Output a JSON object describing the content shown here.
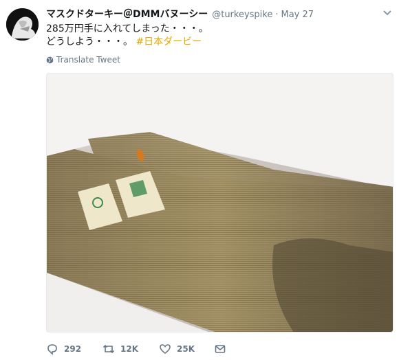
{
  "tweet": {
    "display_name": "マスクドターキー＠DMMバヌーシー",
    "handle": "@turkeyspike",
    "separator": "·",
    "date": "May 27",
    "text_line1": "285万円手に入れてしまった・・・。",
    "text_line2": "どうしよう・・・。",
    "hashtag": "#日本ダービー",
    "translate_label": "Translate Tweet",
    "stats": {
      "replies": "292",
      "retweets": "12K",
      "likes": "25K"
    },
    "colors": {
      "hashtag": "#e6a800",
      "meta": "#657786",
      "text": "#14171a"
    },
    "icons": [
      "chevron-down-icon",
      "globe-icon",
      "reply-icon",
      "retweet-icon",
      "heart-icon",
      "message-icon"
    ]
  }
}
